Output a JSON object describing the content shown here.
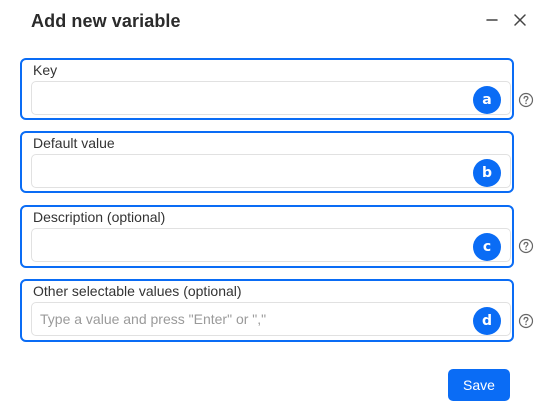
{
  "dialog": {
    "title": "Add new variable",
    "save_label": "Save"
  },
  "fields": [
    {
      "label": "Key",
      "value": "",
      "placeholder": "",
      "badge": "a",
      "help": true
    },
    {
      "label": "Default value",
      "value": "",
      "placeholder": "",
      "badge": "b",
      "help": false
    },
    {
      "label": "Description (optional)",
      "value": "",
      "placeholder": "",
      "badge": "c",
      "help": true
    },
    {
      "label": "Other selectable values (optional)",
      "value": "",
      "placeholder": "Type a value and press \"Enter\" or \",\"",
      "badge": "d",
      "help": true
    }
  ],
  "icons": {
    "minimize": "minimize-icon",
    "close": "close-icon",
    "help": "help-circle-icon"
  },
  "colors": {
    "accent": "#0a6cf5"
  }
}
